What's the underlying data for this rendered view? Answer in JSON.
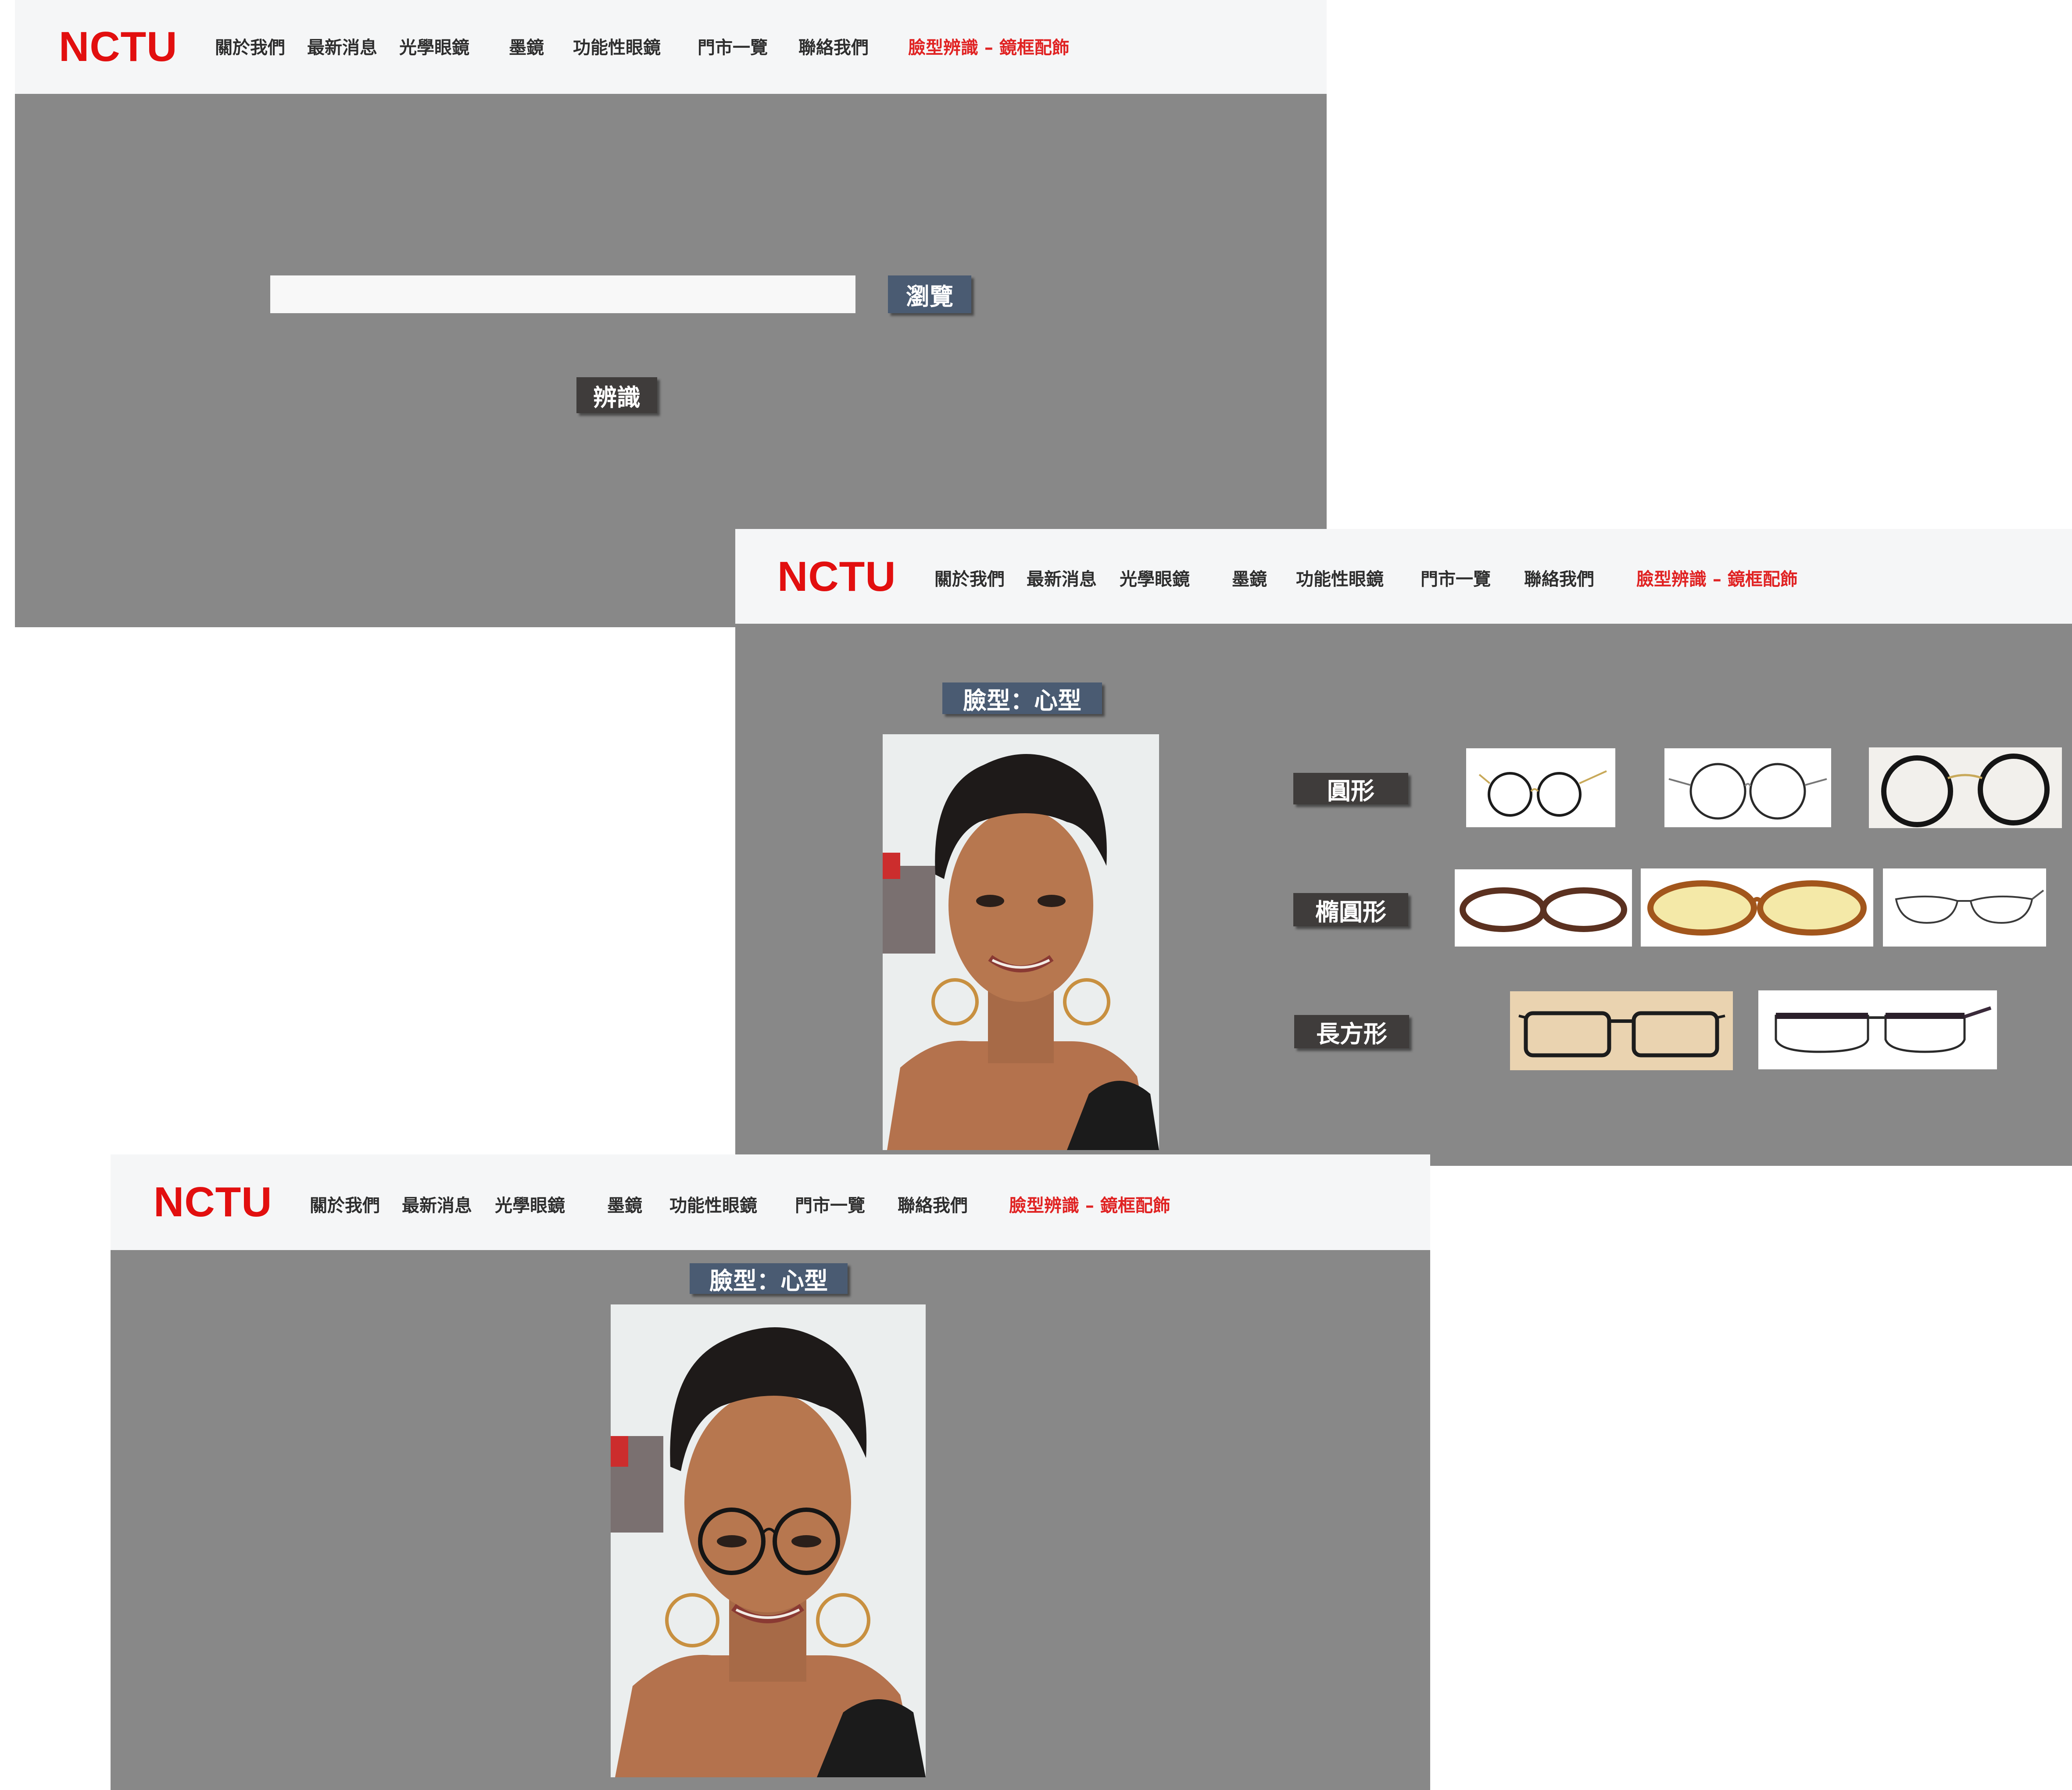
{
  "brand": {
    "logo": "NCTU"
  },
  "nav": {
    "items": [
      "關於我們",
      "最新消息",
      "光學眼鏡",
      "墨鏡",
      "功能性眼鏡",
      "門市一覽",
      "聯絡我們"
    ],
    "active": "臉型辨識 – 鏡框配飾"
  },
  "upload_screen": {
    "file_input_value": "",
    "browse_label": "瀏覽",
    "recognize_label": "辨識"
  },
  "result_screen": {
    "face_shape_label": "臉型：心型",
    "categories": [
      {
        "label": "圓形",
        "frames": [
          "round-thin-gold-frame",
          "round-silver-frame",
          "round-black-frame"
        ]
      },
      {
        "label": "橢圓形",
        "frames": [
          "oval-tortoise-frame",
          "oval-amber-frame",
          "oval-rimless-frame"
        ]
      },
      {
        "label": "長方形",
        "frames": [
          "rect-black-frame",
          "rect-half-rim-frame"
        ]
      }
    ]
  },
  "tryon_screen": {
    "face_shape_label": "臉型：心型"
  },
  "colors": {
    "brand_red": "#e20f0f",
    "active_nav_red": "#e02323",
    "panel_gray": "#888888",
    "navbar_bg": "#f5f6f7",
    "button_blue": "#4a5b72",
    "button_dark": "#3f3c3b"
  }
}
